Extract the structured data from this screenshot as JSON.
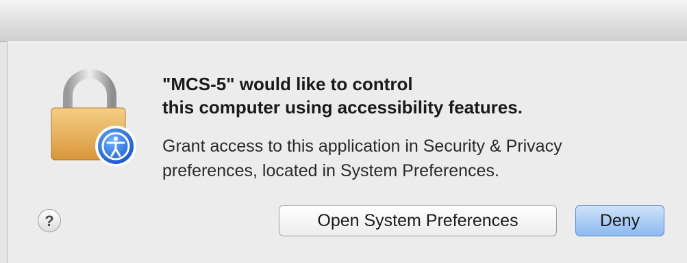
{
  "dialog": {
    "heading_line1": "\"MCS-5\" would like to control",
    "heading_line2": "this computer using accessibility features.",
    "message_line1": "Grant access to this application in Security & Privacy",
    "message_line2": "preferences, located in System Preferences.",
    "help_label": "?",
    "open_button_label": "Open System Preferences",
    "deny_button_label": "Deny"
  },
  "icons": {
    "lock": "lock-icon",
    "accessibility": "accessibility-icon"
  },
  "colors": {
    "default_button": "#8cbaf0",
    "lock_body": "#e2a94f",
    "accessibility_badge": "#1f6fe0"
  }
}
